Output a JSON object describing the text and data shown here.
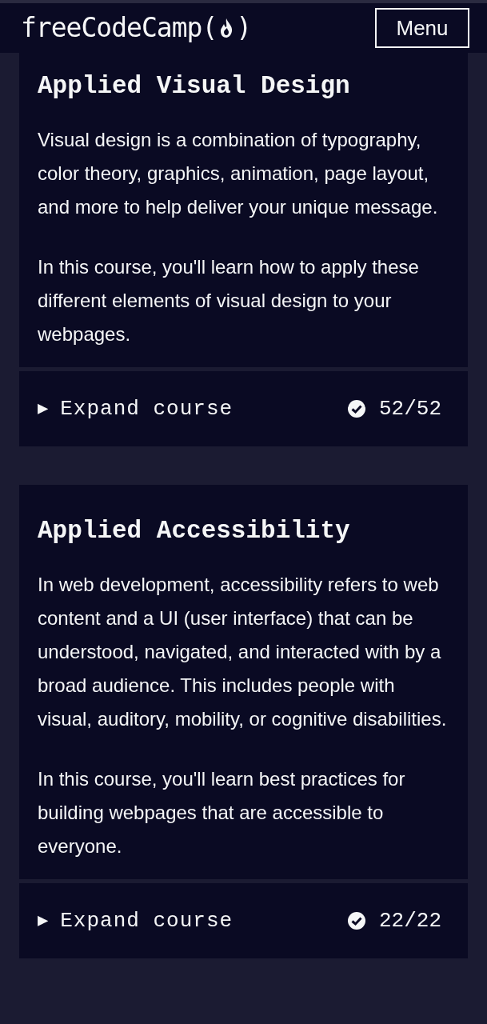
{
  "header": {
    "logo_prefix": "freeCodeCamp(",
    "logo_suffix": ")",
    "menu_button": "Menu"
  },
  "courses": [
    {
      "title": "Applied Visual Design",
      "paragraphs": [
        "Visual design is a combination of typography, color theory, graphics, animation, page layout, and more to help deliver your unique message.",
        "In this course, you'll learn how to apply these different elements of visual design to your webpages."
      ],
      "toggle": "▶",
      "expand_label": "Expand course",
      "completed": true,
      "progress": "52/52"
    },
    {
      "title": "Applied Accessibility",
      "paragraphs": [
        "In web development, accessibility refers to web content and a UI (user interface) that can be understood, navigated, and interacted with by a broad audience. This includes people with visual, auditory, mobility, or cognitive disabilities.",
        "In this course, you'll learn best practices for building webpages that are accessible to everyone."
      ],
      "toggle": "▶",
      "expand_label": "Expand course",
      "completed": true,
      "progress": "22/22"
    }
  ]
}
